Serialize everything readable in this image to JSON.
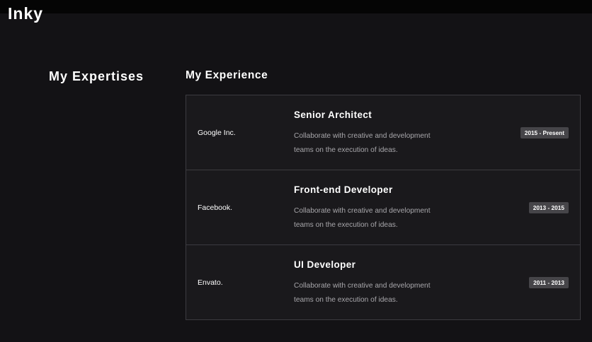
{
  "header": {
    "brand": "Inky"
  },
  "expertises": {
    "title": "My Expertises"
  },
  "experience": {
    "title": "My Experience",
    "items": [
      {
        "company": "Google Inc.",
        "role": "Senior Architect",
        "description": "Collaborate with creative and development teams on the execution of ideas.",
        "period": "2015 - Present"
      },
      {
        "company": "Facebook.",
        "role": "Front-end Developer",
        "description": "Collaborate with creative and development teams on the execution of ideas.",
        "period": "2013 - 2015"
      },
      {
        "company": "Envato.",
        "role": "UI Developer",
        "description": "Collaborate with creative and development teams on the execution of ideas.",
        "period": "2011 - 2013"
      }
    ]
  },
  "colors": {
    "background": "#131215",
    "topbar": "#050505",
    "card": "#1a191c",
    "border": "#3c3b40",
    "badge": "#464549",
    "muted_text": "#a8a7ab"
  }
}
